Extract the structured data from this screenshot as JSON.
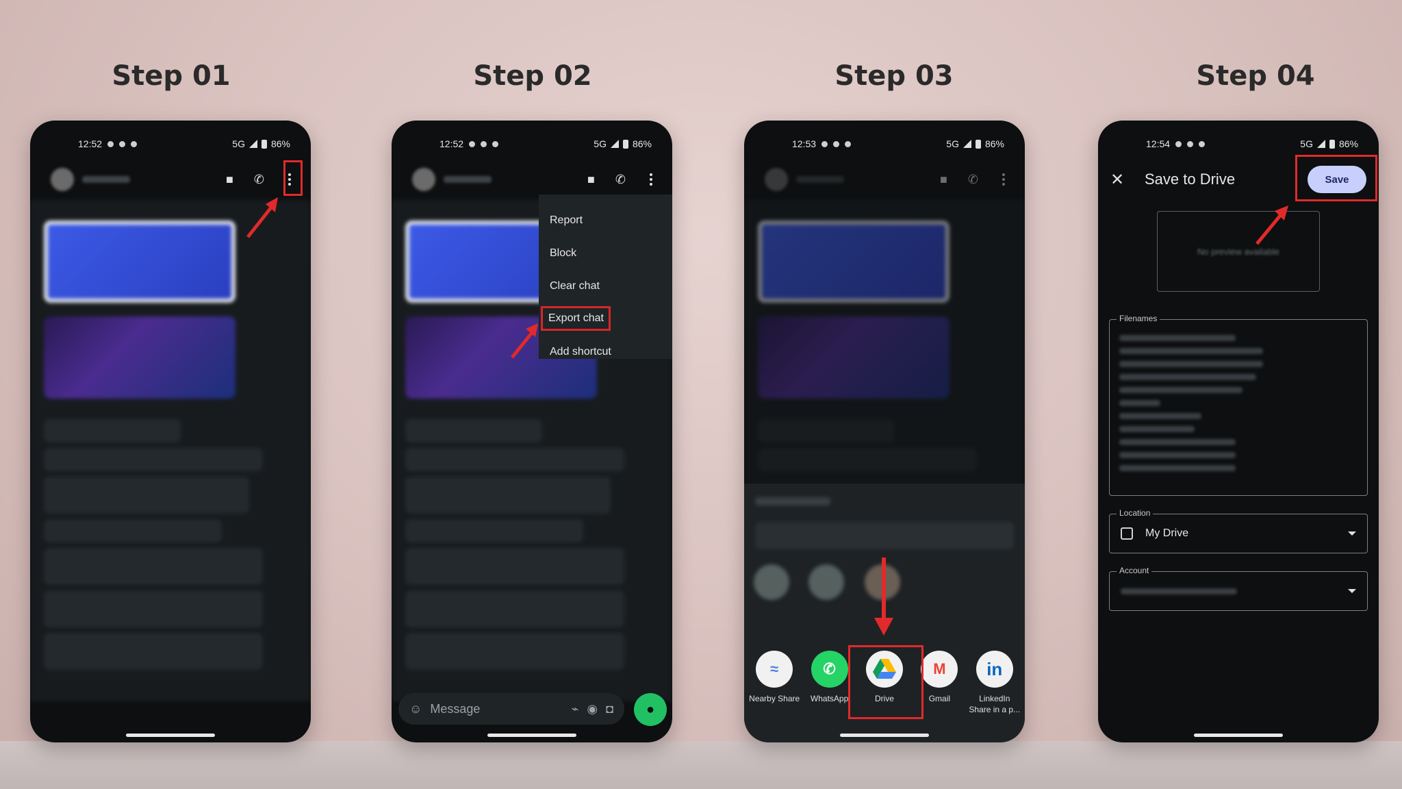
{
  "steps": [
    {
      "title": "Step 01",
      "time": "12:52"
    },
    {
      "title": "Step 02",
      "time": "12:52"
    },
    {
      "title": "Step 03",
      "time": "12:53"
    },
    {
      "title": "Step 04",
      "time": "12:54"
    }
  ],
  "status": {
    "network": "5G",
    "battery": "86%"
  },
  "menu": {
    "items": [
      "Report",
      "Block",
      "Clear chat",
      "Export chat",
      "Add shortcut"
    ]
  },
  "composer": {
    "placeholder": "Message"
  },
  "share_apps": [
    {
      "label": "Nearby Share",
      "icon": "nearby-share-icon"
    },
    {
      "label": "WhatsApp",
      "icon": "whatsapp-icon"
    },
    {
      "label": "Drive",
      "icon": "drive-icon"
    },
    {
      "label": "Gmail",
      "icon": "gmail-icon"
    },
    {
      "label": "LinkedIn",
      "sublabel": "Share in a p...",
      "icon": "linkedin-icon"
    }
  ],
  "drive": {
    "title": "Save to Drive",
    "save_label": "Save",
    "filenames_label": "Filenames",
    "location_label": "Location",
    "location_value": "My Drive",
    "account_label": "Account"
  },
  "colors": {
    "highlight": "#e12a2a",
    "accent_green": "#21c063",
    "save_bg": "#c8cffc"
  }
}
